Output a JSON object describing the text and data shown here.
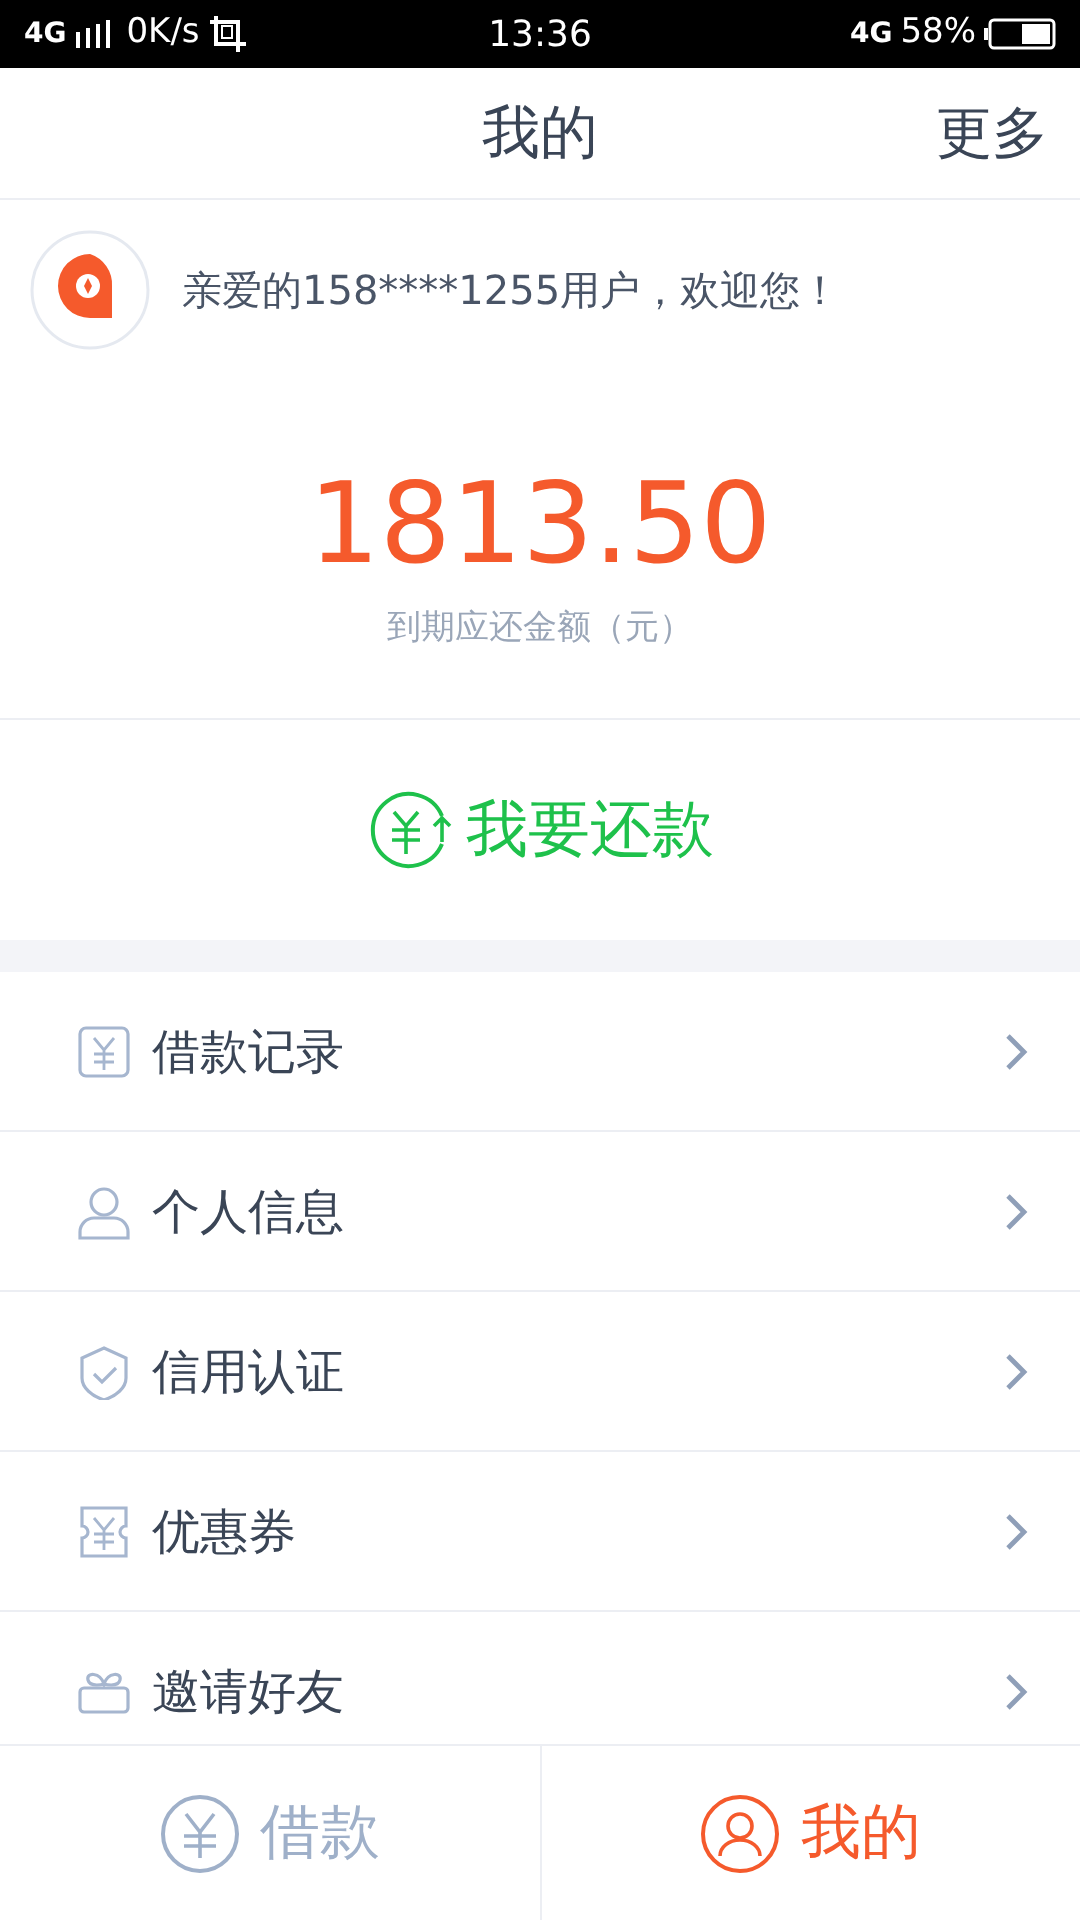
{
  "status_bar": {
    "network_left": "4G",
    "speed": "0K/s",
    "time": "13:36",
    "network_right": "4G",
    "battery": "58%"
  },
  "header": {
    "title": "我的",
    "action": "更多"
  },
  "welcome": {
    "text": "亲爱的158****1255用户，欢迎您！"
  },
  "amount": {
    "value": "1813.50",
    "caption": "到期应还金额（元）"
  },
  "repay_button": {
    "label": "我要还款"
  },
  "menu": [
    {
      "kind": "record",
      "label": "借款记录"
    },
    {
      "kind": "person",
      "label": "个人信息"
    },
    {
      "kind": "shield",
      "label": "信用认证"
    },
    {
      "kind": "coupon",
      "label": "优惠券"
    },
    {
      "kind": "gift",
      "label": "邀请好友"
    }
  ],
  "tab_bar": [
    {
      "kind": "loan",
      "label": "借款",
      "selected": false
    },
    {
      "kind": "mine",
      "label": "我的",
      "selected": true
    }
  ]
}
